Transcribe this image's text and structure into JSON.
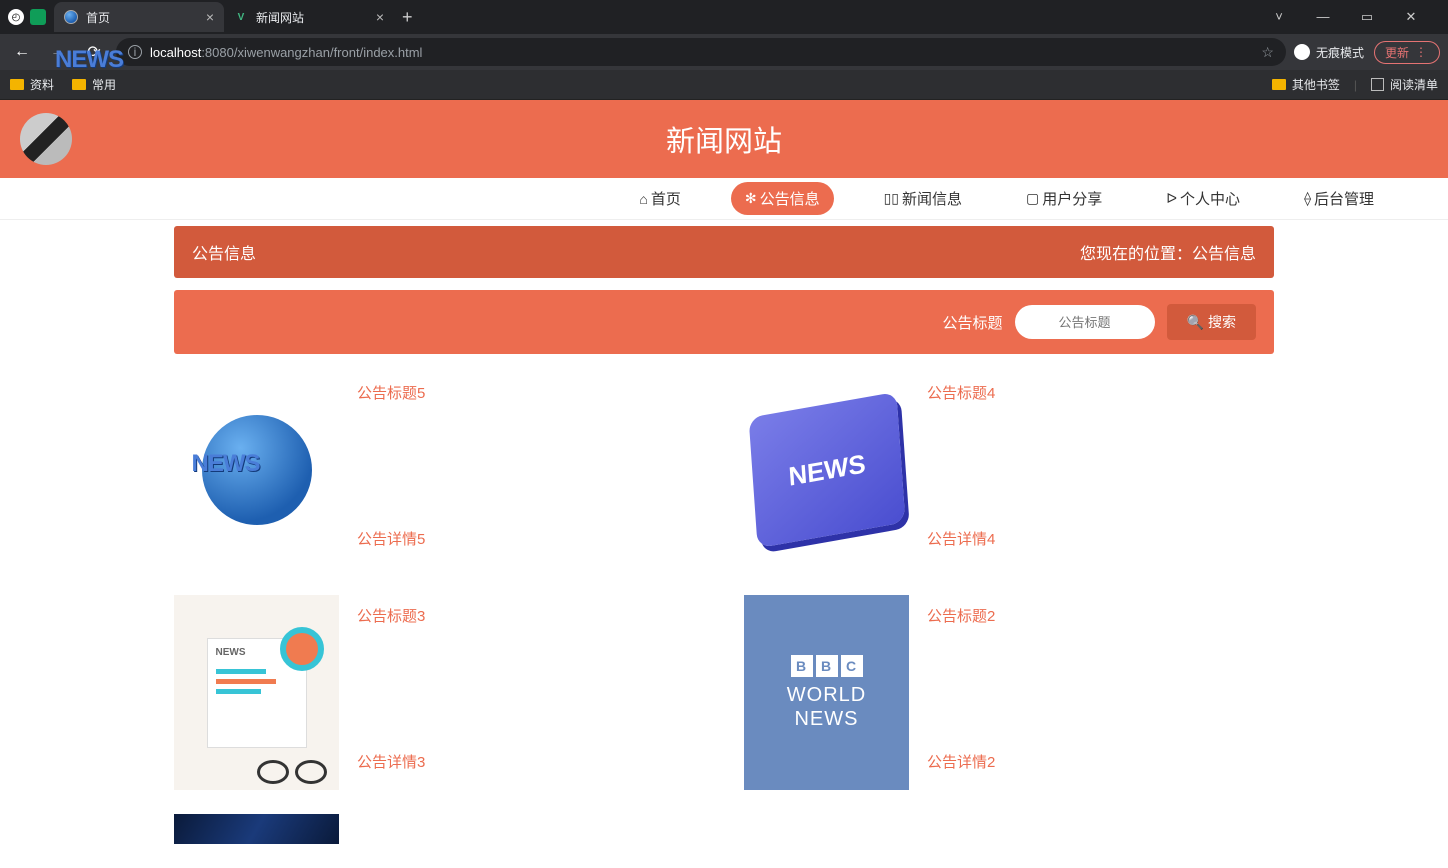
{
  "browser": {
    "tabs": [
      {
        "title": "首页",
        "active": true
      },
      {
        "title": "新闻网站",
        "active": false
      }
    ],
    "url_host": "localhost",
    "url_rest": ":8080/xiwenwangzhan/front/index.html",
    "incognito": "无痕模式",
    "update": "更新",
    "bookmarks": {
      "b1": "资料",
      "b2": "常用",
      "other": "其他书签",
      "readlist": "阅读清单"
    }
  },
  "site": {
    "title": "新闻网站",
    "nav": {
      "home": "首页",
      "announce": "公告信息",
      "news": "新闻信息",
      "share": "用户分享",
      "profile": "个人中心",
      "admin": "后台管理"
    }
  },
  "crumb": {
    "section": "公告信息",
    "location_prefix": "您现在的位置：",
    "location": "公告信息"
  },
  "search": {
    "label": "公告标题",
    "placeholder": "公告标题",
    "button": "搜索"
  },
  "items": [
    {
      "title": "公告标题5",
      "detail": "公告详情5"
    },
    {
      "title": "公告标题4",
      "detail": "公告详情4"
    },
    {
      "title": "公告标题3",
      "detail": "公告详情3"
    },
    {
      "title": "公告标题2",
      "detail": "公告详情2"
    }
  ]
}
